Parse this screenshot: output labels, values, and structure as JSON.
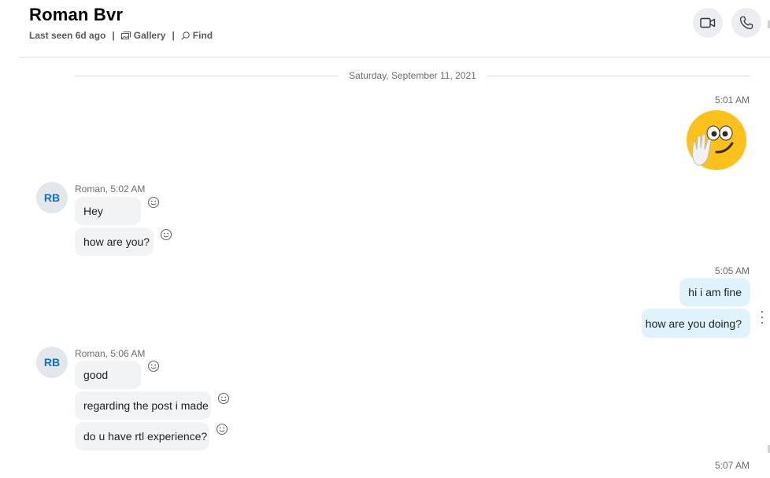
{
  "header": {
    "contact_name": "Roman Bvr",
    "last_seen": "Last seen 6d ago",
    "separator": "|",
    "gallery_label": "Gallery",
    "find_label": "Find"
  },
  "conversation": {
    "date_separator": "Saturday, September 11, 2021",
    "groups": [
      {
        "sender": "me",
        "time": "5:01 AM",
        "content": "wave-emoji"
      },
      {
        "sender": "Roman",
        "avatar_initials": "RB",
        "meta": "Roman, 5:02 AM",
        "messages": [
          "Hey",
          "how are you?"
        ]
      },
      {
        "sender": "me",
        "time": "5:05 AM",
        "messages": [
          "hi i am fine",
          "how are you doing?"
        ]
      },
      {
        "sender": "Roman",
        "avatar_initials": "RB",
        "meta": "Roman, 5:06 AM",
        "messages": [
          "good",
          "regarding the post i made",
          "do u have rtl experience?"
        ]
      },
      {
        "sender": "me",
        "time": "5:07 AM"
      }
    ]
  },
  "icons": {
    "gallery": "gallery-icon",
    "find": "search-icon",
    "video_call": "video-camera-icon",
    "audio_call": "phone-icon",
    "reaction": "smiley-icon",
    "more": "more-vertical-icon"
  },
  "colors": {
    "incoming_bubble": "#f2f3f5",
    "outgoing_bubble": "#dff3fd",
    "avatar_text": "#0a73c9",
    "avatar_bg": "#e3e6ea"
  }
}
